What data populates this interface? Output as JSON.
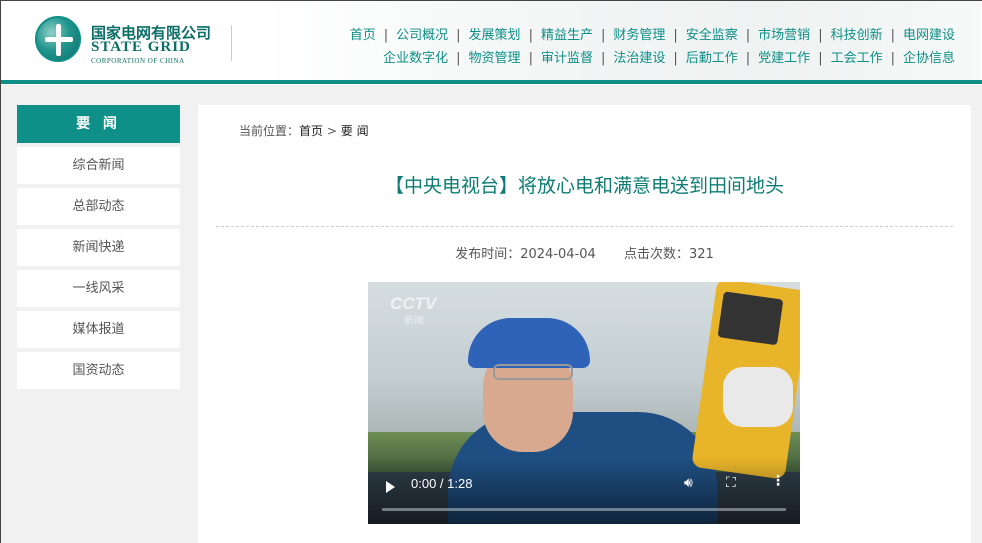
{
  "header": {
    "logo_cn": "国家电网有限公司",
    "logo_en": "STATE GRID",
    "logo_sub": "CORPORATION OF CHINA",
    "nav_row1": [
      "首页",
      "公司概况",
      "发展策划",
      "精益生产",
      "财务管理",
      "安全监察",
      "市场营销",
      "科技创新",
      "电网建设"
    ],
    "nav_row2": [
      "企业数字化",
      "物资管理",
      "审计监督",
      "法治建设",
      "后勤工作",
      "党建工作",
      "工会工作",
      "企协信息"
    ],
    "accent_color": "#0e8f87"
  },
  "sidebar": {
    "title": "要 闻",
    "items": [
      "综合新闻",
      "总部动态",
      "新闻快递",
      "一线风采",
      "媒体报道",
      "国资动态"
    ]
  },
  "breadcrumb": {
    "label": "当前位置：",
    "home": "首页",
    "separator": ">",
    "current": "要 闻"
  },
  "article": {
    "title": "【中央电视台】将放心电和满意电送到田间地头",
    "publish_label": "发布时间：",
    "publish_date": "2024-04-04",
    "views_label": "点击次数：",
    "views": "321"
  },
  "video": {
    "watermark": "CCTV",
    "watermark_sub": "新闻",
    "time": "0:00 / 1:28",
    "progress": 0
  }
}
